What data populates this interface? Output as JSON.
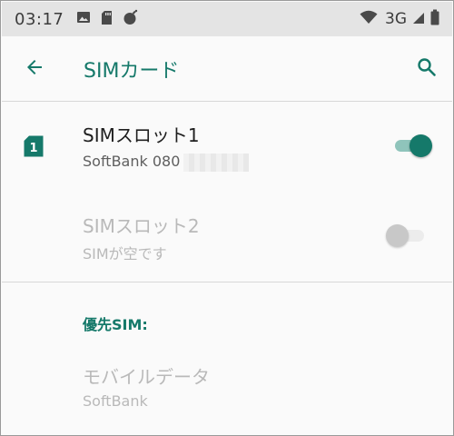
{
  "status_bar": {
    "time": "03:17",
    "network": "3G",
    "icons": [
      "image-icon",
      "sd-card-icon",
      "bomb-icon",
      "wifi-icon",
      "signal-icon",
      "battery-icon"
    ]
  },
  "app_bar": {
    "title": "SIMカード",
    "back_icon": "arrow-back-icon",
    "search_icon": "search-icon",
    "accent_color": "#15796a"
  },
  "sim_slots": [
    {
      "badge": "1",
      "title": "SIMスロット1",
      "subtitle": "SoftBank 080",
      "enabled": true,
      "toggle_on": true
    },
    {
      "title": "SIMスロット2",
      "subtitle": "SIMが空です",
      "enabled": false,
      "toggle_on": false
    }
  ],
  "preferred_sim": {
    "header": "優先SIM:",
    "items": [
      {
        "title": "モバイルデータ",
        "subtitle": "SoftBank",
        "enabled": false
      }
    ]
  }
}
